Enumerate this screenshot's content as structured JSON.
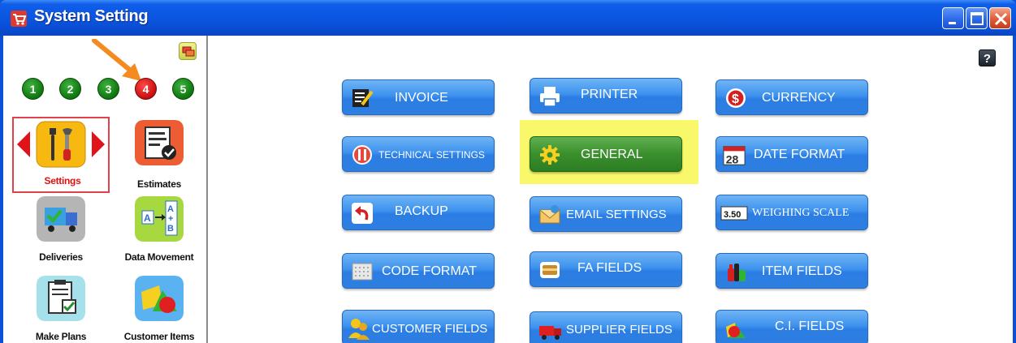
{
  "window": {
    "title": "System Setting"
  },
  "sidebar": {
    "pages": [
      "1",
      "2",
      "3",
      "4",
      "5"
    ],
    "active_page": "4",
    "tiles": [
      {
        "label": "Settings",
        "icon": "wrench-screwdriver-icon",
        "selected": true
      },
      {
        "label": "Estimates",
        "icon": "document-check-icon"
      },
      {
        "label": "Deliveries",
        "icon": "delivery-truck-icon"
      },
      {
        "label": "Data Movement",
        "icon": "data-movement-icon"
      },
      {
        "label": "Make Plans",
        "icon": "clipboard-check-icon"
      },
      {
        "label": "Customer Items",
        "icon": "shapes-icon"
      }
    ]
  },
  "main": {
    "help_label": "?",
    "buttons": [
      {
        "label": "INVOICE",
        "icon": "invoice-edit-icon"
      },
      {
        "label": "PRINTER",
        "icon": "printer-icon"
      },
      {
        "label": "CURRENCY",
        "icon": "dollar-icon"
      },
      {
        "label": "TECHNICAL SETTINGS",
        "icon": "tools-icon"
      },
      {
        "label": "GENERAL",
        "icon": "gear-icon",
        "highlighted": true
      },
      {
        "label": "DATE FORMAT",
        "icon": "calendar-icon",
        "icon_text": "28"
      },
      {
        "label": "BACKUP",
        "icon": "undo-arrow-icon"
      },
      {
        "label": "EMAIL SETTINGS",
        "icon": "email-icon"
      },
      {
        "label": "WEIGHING SCALE",
        "icon": "scale-readout-icon",
        "icon_text": "3.50"
      },
      {
        "label": "CODE FORMAT",
        "icon": "code-grid-icon"
      },
      {
        "label": "FA FIELDS",
        "icon": "fa-fields-icon"
      },
      {
        "label": "ITEM FIELDS",
        "icon": "bottles-icon"
      },
      {
        "label": "CUSTOMER FIELDS",
        "icon": "customers-icon"
      },
      {
        "label": "SUPPLIER FIELDS",
        "icon": "supplier-truck-icon"
      },
      {
        "label": "C.I. FIELDS",
        "icon": "shapes-icon"
      }
    ]
  },
  "colors": {
    "accent": "#2b7de4",
    "active_green": "#3a8f2d",
    "highlight": "#f8f86a",
    "selected_border": "#e0424a",
    "arrow": "#f58a1f"
  }
}
